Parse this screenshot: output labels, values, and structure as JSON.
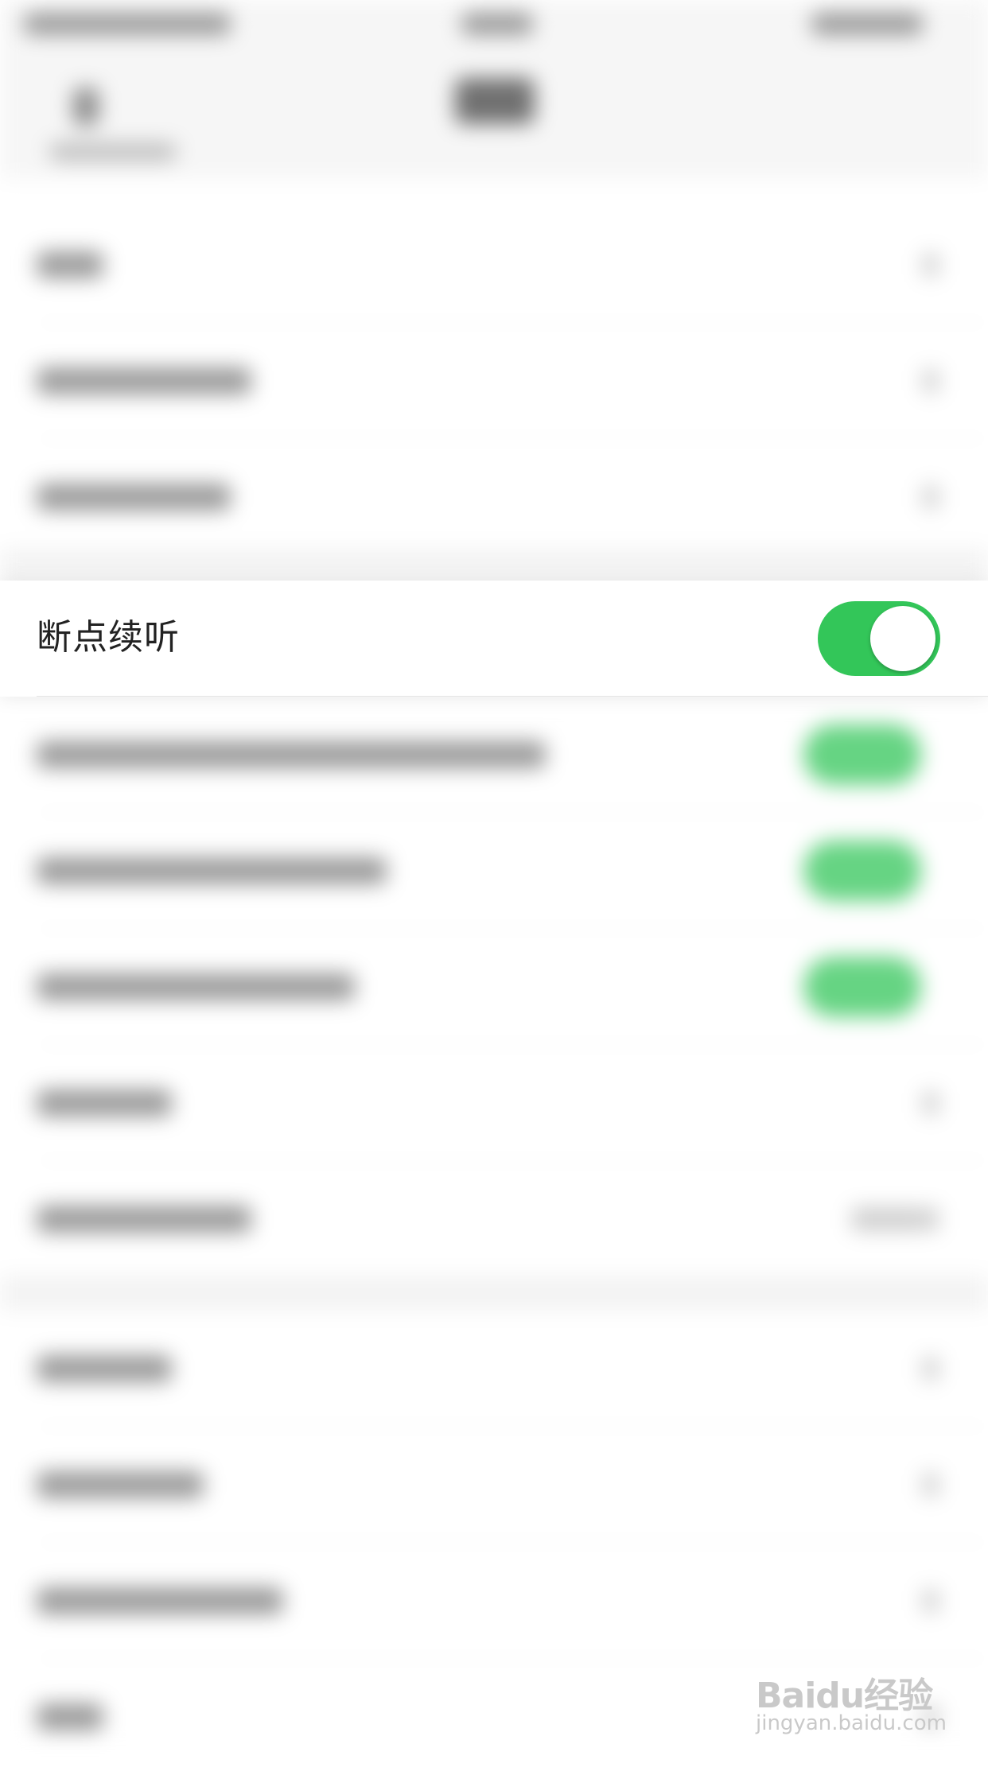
{
  "setting": {
    "label": "断点续听",
    "enabled": true,
    "toggle_color": "#33c659"
  },
  "watermark": {
    "logo": "Baidu经验",
    "site": "jingyan.baidu.com"
  }
}
